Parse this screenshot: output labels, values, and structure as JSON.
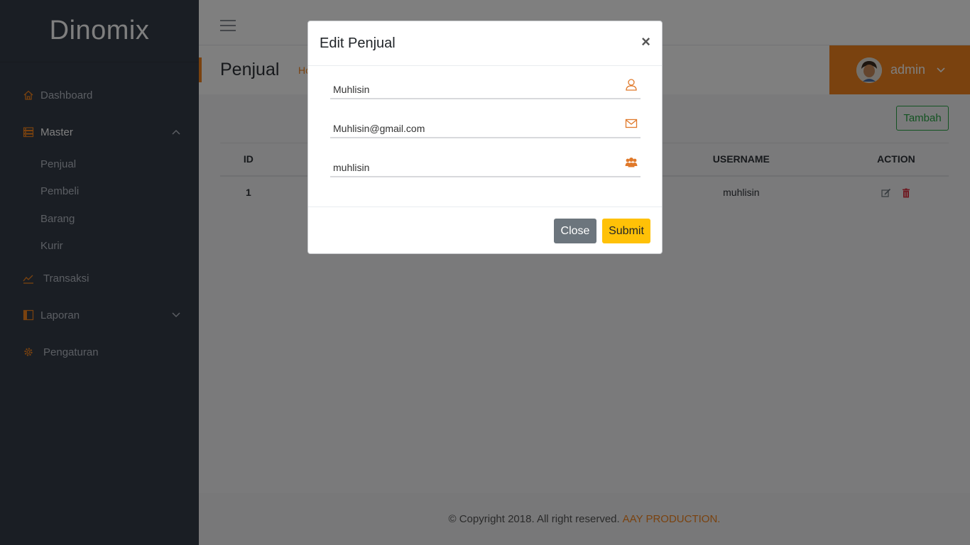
{
  "app": {
    "brand": "Dinomix"
  },
  "sidebar": {
    "items": [
      {
        "label": "Dashboard",
        "icon": "home-icon"
      },
      {
        "label": "Master",
        "icon": "server-icon",
        "expanded": true,
        "children": [
          "Penjual",
          "Pembeli",
          "Barang",
          "Kurir"
        ]
      },
      {
        "label": "Transaksi",
        "icon": "trend-chart-icon"
      },
      {
        "label": "Laporan",
        "icon": "book-icon",
        "expanded": false
      },
      {
        "label": "Pengaturan",
        "icon": "gear-icon"
      }
    ]
  },
  "header": {
    "page_title": "Penjual",
    "breadcrumb": "Home",
    "user": "admin"
  },
  "content": {
    "add_button": "Tambah",
    "table": {
      "columns": [
        "ID",
        "USERNAME",
        "ACTION"
      ],
      "rows": [
        {
          "id": "1",
          "username": "muhlisin"
        }
      ]
    }
  },
  "footer": {
    "text": "© Copyright 2018. All right reserved.",
    "link": "AAY PRODUCTION."
  },
  "modal": {
    "title": "Edit Penjual",
    "close_symbol": "×",
    "fields": {
      "name": "Muhlisin",
      "email": "Muhlisin@gmail.com",
      "username": "muhlisin"
    },
    "close_label": "Close",
    "submit_label": "Submit"
  },
  "colors": {
    "accent": "#f5851f",
    "sidebar_bg": "#353c48",
    "success": "#28a745",
    "warning": "#ffc107",
    "danger": "#dc3545",
    "secondary": "#6c757d"
  }
}
